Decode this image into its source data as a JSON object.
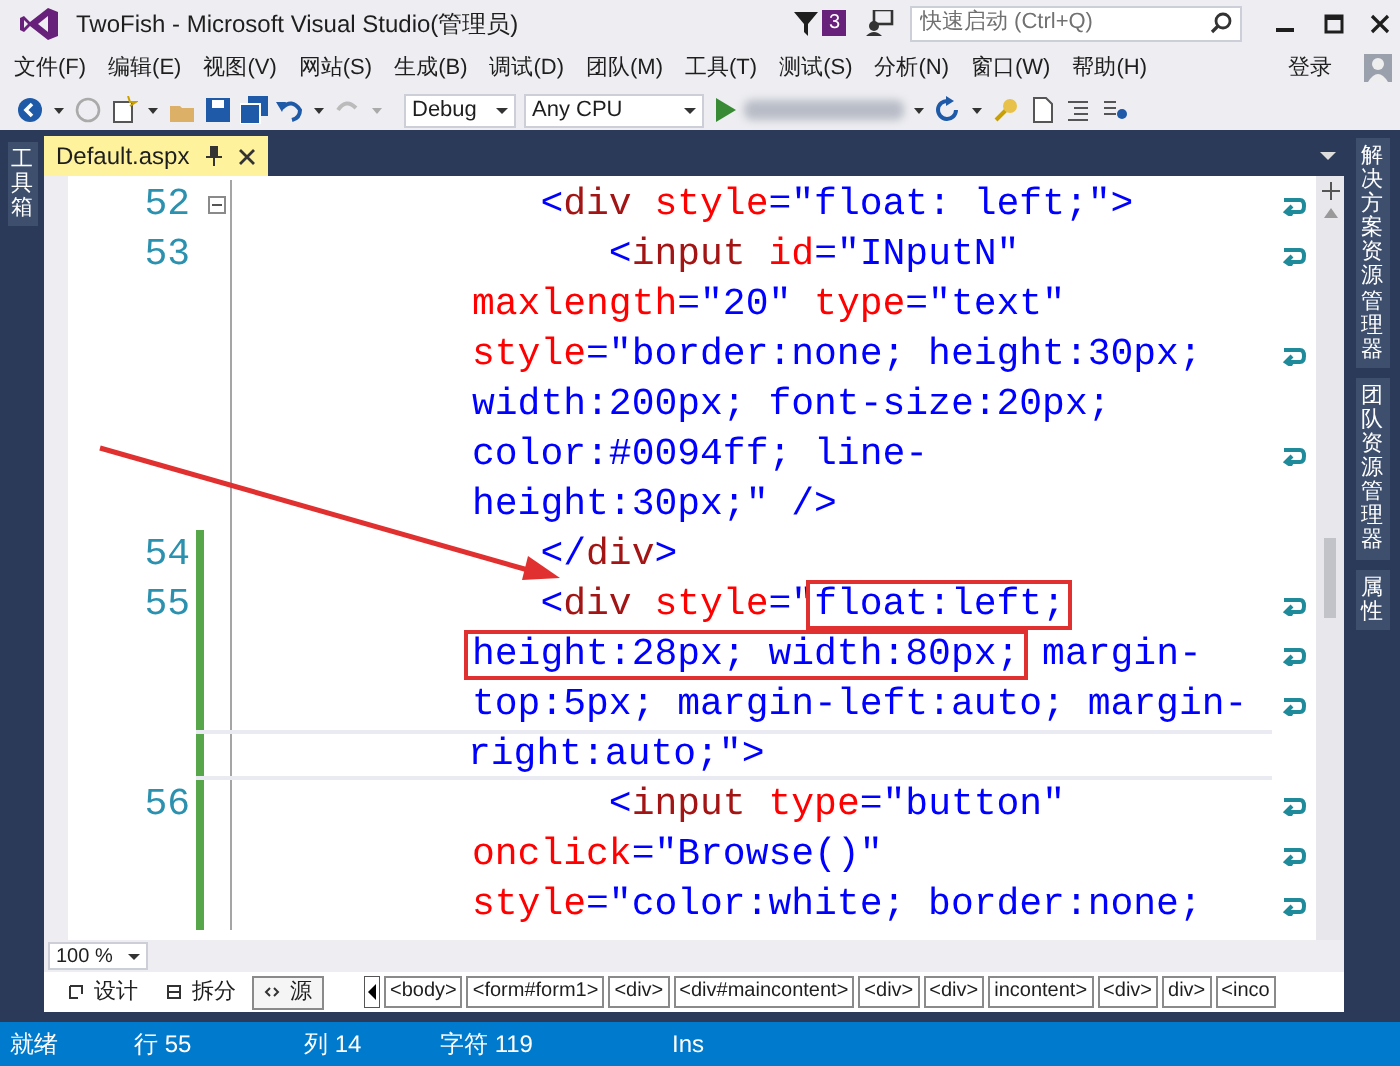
{
  "window": {
    "title": "TwoFish - Microsoft Visual Studio(管理员)",
    "notification_count": "3",
    "quick_launch": {
      "placeholder": "快速启动 (Ctrl+Q)"
    }
  },
  "menu": [
    "文件(F)",
    "编辑(E)",
    "视图(V)",
    "网站(S)",
    "生成(B)",
    "调试(D)",
    "团队(M)",
    "工具(T)",
    "测试(S)",
    "分析(N)",
    "窗口(W)",
    "帮助(H)"
  ],
  "sign_in": "登录",
  "toolbar": {
    "configuration": "Debug",
    "platform": "Any CPU"
  },
  "left_panel_tabs": [
    "工具箱"
  ],
  "right_panel_tabs": [
    "解决方案资源管理器",
    "团队资源管理器",
    "属性"
  ],
  "document_tabs": [
    {
      "label": "Default.aspx",
      "selected": true
    }
  ],
  "code_lines": [
    {
      "number": "52",
      "foldable": true,
      "changed": false,
      "current": false,
      "wrap_marker": true,
      "tokens": [
        {
          "kind": "delim",
          "text": "   <"
        },
        {
          "kind": "tag",
          "text": "div"
        },
        {
          "kind": "attr",
          "text": " style"
        },
        {
          "kind": "value",
          "text": "=\"float: left;\">"
        }
      ]
    },
    {
      "number": "53",
      "foldable": false,
      "changed": false,
      "current": false,
      "wrap_marker": true,
      "tokens": [
        {
          "kind": "delim",
          "text": "      <"
        },
        {
          "kind": "tag",
          "text": "input"
        },
        {
          "kind": "attr",
          "text": " id"
        },
        {
          "kind": "value",
          "text": "=\"INputN\""
        }
      ]
    },
    {
      "foldable": false,
      "changed": false,
      "current": false,
      "wrap_marker": false,
      "tokens": [
        {
          "kind": "attr",
          "text": "maxlength"
        },
        {
          "kind": "value",
          "text": "=\"20\""
        },
        {
          "kind": "attr",
          "text": " type"
        },
        {
          "kind": "value",
          "text": "=\"text\""
        }
      ]
    },
    {
      "foldable": false,
      "changed": false,
      "current": false,
      "wrap_marker": true,
      "tokens": [
        {
          "kind": "attr",
          "text": "style"
        },
        {
          "kind": "value",
          "text": "=\"border:none; height:30px;"
        }
      ]
    },
    {
      "foldable": false,
      "changed": false,
      "current": false,
      "wrap_marker": false,
      "tokens": [
        {
          "kind": "value",
          "text": "width:200px; font-size:20px;"
        }
      ]
    },
    {
      "foldable": false,
      "changed": false,
      "current": false,
      "wrap_marker": true,
      "tokens": [
        {
          "kind": "value",
          "text": "color:#0094ff; line-"
        }
      ]
    },
    {
      "foldable": false,
      "changed": false,
      "current": false,
      "wrap_marker": false,
      "tokens": [
        {
          "kind": "value",
          "text": "height:30px;\""
        },
        {
          "kind": "delim",
          "text": " />"
        }
      ]
    },
    {
      "number": "54",
      "foldable": false,
      "changed": true,
      "current": false,
      "wrap_marker": false,
      "tokens": [
        {
          "kind": "delim",
          "text": "   </"
        },
        {
          "kind": "tag",
          "text": "div"
        },
        {
          "kind": "delim",
          "text": ">"
        }
      ]
    },
    {
      "number": "55",
      "foldable": false,
      "changed": true,
      "current": false,
      "wrap_marker": true,
      "tokens": [
        {
          "kind": "delim",
          "text": "   <"
        },
        {
          "kind": "tag",
          "text": "div"
        },
        {
          "kind": "attr",
          "text": " style"
        },
        {
          "kind": "value",
          "text": "=\""
        },
        {
          "kind": "value",
          "text": "float:left;",
          "highlighted": true
        }
      ]
    },
    {
      "foldable": false,
      "changed": true,
      "current": false,
      "wrap_marker": true,
      "tokens": [
        {
          "kind": "value",
          "text": "height:28px; width:80px;",
          "highlighted": true
        },
        {
          "kind": "value",
          "text": " margin-"
        }
      ]
    },
    {
      "foldable": false,
      "changed": true,
      "current": false,
      "wrap_marker": true,
      "tokens": [
        {
          "kind": "value",
          "text": "top:5px; margin-left:auto; margin-"
        }
      ]
    },
    {
      "foldable": false,
      "changed": true,
      "current": true,
      "wrap_marker": false,
      "tokens": [
        {
          "kind": "value",
          "text": "right:auto;\">"
        }
      ]
    },
    {
      "number": "56",
      "foldable": false,
      "changed": true,
      "current": false,
      "wrap_marker": true,
      "tokens": [
        {
          "kind": "delim",
          "text": "      <"
        },
        {
          "kind": "tag",
          "text": "input"
        },
        {
          "kind": "attr",
          "text": " type"
        },
        {
          "kind": "value",
          "text": "=\"button\""
        }
      ]
    },
    {
      "foldable": false,
      "changed": true,
      "current": false,
      "wrap_marker": true,
      "tokens": [
        {
          "kind": "attr",
          "text": "onclick"
        },
        {
          "kind": "value",
          "text": "=\"Browse()\""
        }
      ]
    },
    {
      "foldable": false,
      "changed": true,
      "current": false,
      "wrap_marker": true,
      "tokens": [
        {
          "kind": "attr",
          "text": "style"
        },
        {
          "kind": "value",
          "text": "=\"color:white; border:none;"
        }
      ]
    }
  ],
  "zoom": "100 %",
  "view_buttons": [
    {
      "label": "设计",
      "selected": false
    },
    {
      "label": "拆分",
      "selected": false
    },
    {
      "label": "源",
      "selected": true
    }
  ],
  "breadcrumbs": [
    "<body>",
    "<form#form1>",
    "<div>",
    "<div#maincontent>",
    "<div>",
    "<div>",
    "incontent>",
    "<div>",
    "div>",
    "<inco"
  ],
  "status_bar": {
    "state": "就绪",
    "line": "行 55",
    "column": "列 14",
    "char": "字符 119",
    "mode": "Ins"
  }
}
